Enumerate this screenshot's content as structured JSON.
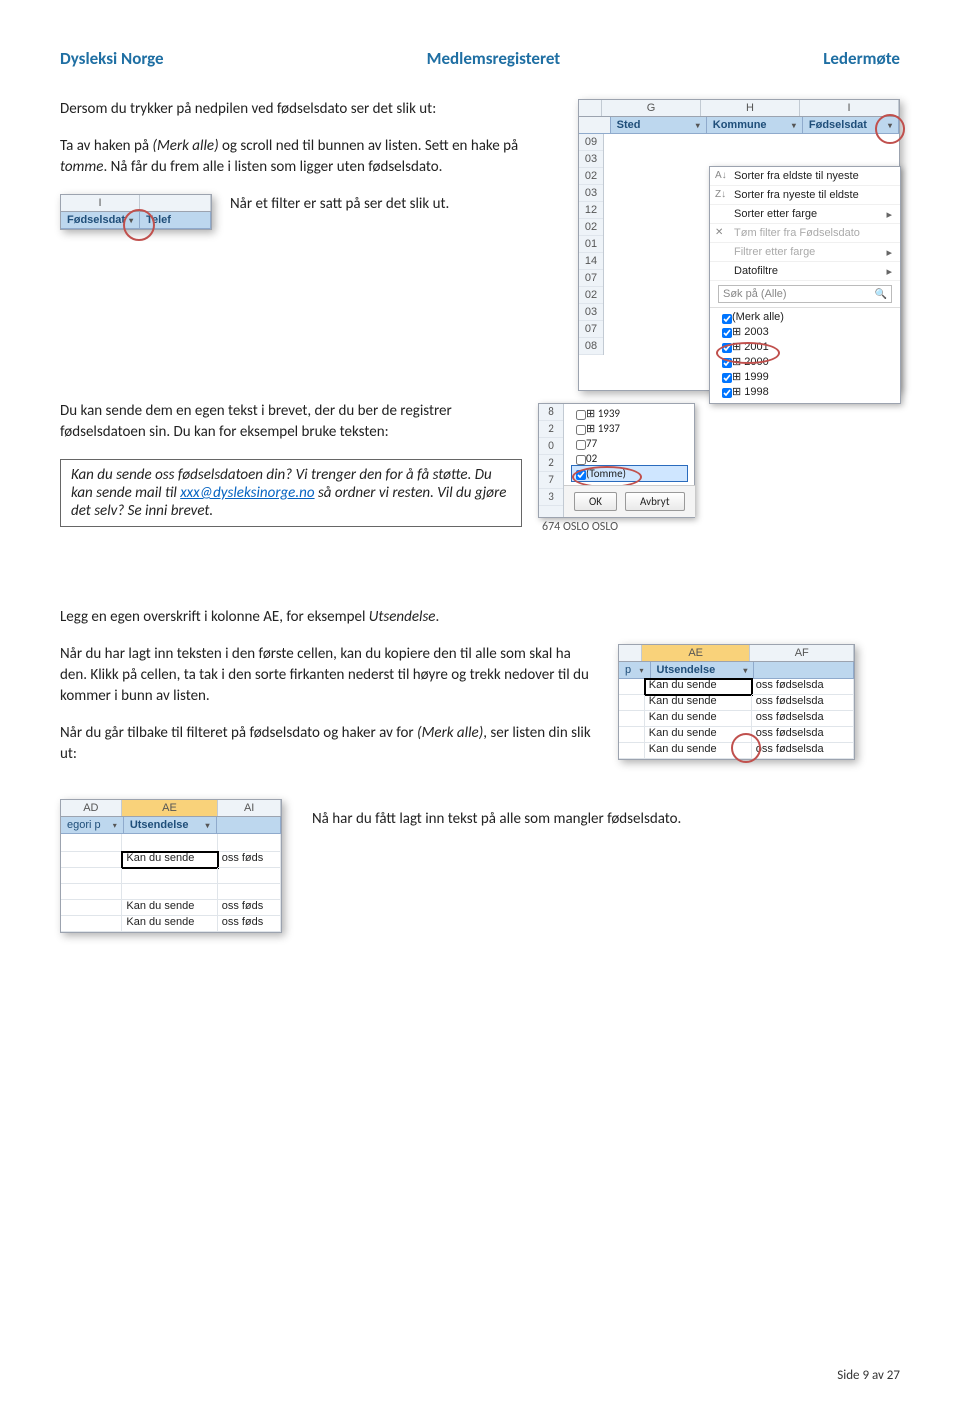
{
  "header": {
    "left": "Dysleksi Norge",
    "center": "Medlemsregisteret",
    "right": "Ledermøte"
  },
  "p1a": "Dersom du trykker på nedpilen ved fødselsdato ser det slik ut:",
  "p1b_1": "Ta av haken på ",
  "p1b_em1": "(Merk alle)",
  "p1b_2": " og scroll ned til bunnen av listen. Sett en hake på ",
  "p1b_em2": "tomme",
  "p1b_3": ". Nå får du frem alle i listen som ligger uten fødselsdato.",
  "p1c": "Når et filter er satt på ser det slik ut.",
  "p2a": "Du kan sende dem en egen tekst i brevet, der du ber de registrer fødselsdatoen sin. Du kan for eksempel bruke teksten:",
  "box_1": "Kan du sende oss fødselsdatoen din? Vi trenger den for å få støtte. Du kan sende mail til ",
  "box_link": "xxx@dysleksinorge.no",
  "box_2": " så ordner vi resten. Vil du gjøre det selv? Se inni brevet.",
  "p3a_1": "Legg en egen overskrift i kolonne AE, for eksempel ",
  "p3a_em": "Utsendelse",
  "p3a_2": ".",
  "p3b": "Når du har lagt inn teksten i den første cellen, kan du kopiere den til alle som skal ha den. Klikk på cellen, ta tak i den sorte firkanten nederst til høyre og trekk nedover til du kommer i bunn av listen.",
  "p3c_1": "Når du går tilbake til filteret på fødselsdato og haker av for ",
  "p3c_em": "(Merk alle)",
  "p3c_2": ", ser listen din slik ut:",
  "p4": "Nå har du fått lagt inn tekst på alle som mangler fødselsdato.",
  "footer": "Side 9 av 27",
  "xl_filter": {
    "cols": [
      "G",
      "H",
      "I"
    ],
    "hdrs": [
      "Sted",
      "Kommune",
      "Fødselsdat"
    ],
    "rows": [
      "09",
      "03",
      "02",
      "03",
      "12",
      "02",
      "01",
      "14",
      "07",
      "02",
      "03",
      "07",
      "08"
    ],
    "menu": {
      "sort_asc": "Sorter fra eldste til nyeste",
      "sort_desc": "Sorter fra nyeste til eldste",
      "sort_color": "Sorter etter farge",
      "clear": "Tøm filter fra Fødselsdato",
      "filter_color": "Filtrer etter farge",
      "date_filters": "Datofiltre",
      "search": "Søk på (Alle)",
      "opts": [
        "(Merk alle)",
        "2003",
        "2001",
        "2000",
        "1999",
        "1998"
      ],
      "ok": "OK",
      "cancel": "Avbryt"
    }
  },
  "xl_filter2": {
    "rows": [
      "8",
      "2",
      "0",
      "2",
      "7",
      "3"
    ],
    "opts": [
      "1939",
      "1937",
      "77",
      "02",
      "(Tomme)"
    ],
    "ok": "OK",
    "cancel": "Avbryt",
    "bottom": "674  OSLO        OSLO"
  },
  "xl_small": {
    "col": "I",
    "h1": "Fødselsdat",
    "h2": "Telef"
  },
  "xl_ae": {
    "cols": [
      "AE",
      "AF"
    ],
    "p_label": "p",
    "hdr": "Utsendelse",
    "rows": [
      "Kan du sende oss fødselsda",
      "Kan du sende oss fødselsda",
      "Kan du sende oss fødselsda",
      "Kan du sende oss fødselsda",
      "Kan du sende oss fødselsda"
    ],
    "short": "Kan du sende"
  },
  "xl_ae2": {
    "cols": [
      "AD",
      "AE",
      "AI"
    ],
    "h1": "egori p",
    "h2": "Utsendelse",
    "rows": [
      "Kan du sende oss føds",
      "",
      "",
      "Kan du sende oss føds",
      "Kan du sende oss føds"
    ],
    "short": "Kan du sende"
  }
}
